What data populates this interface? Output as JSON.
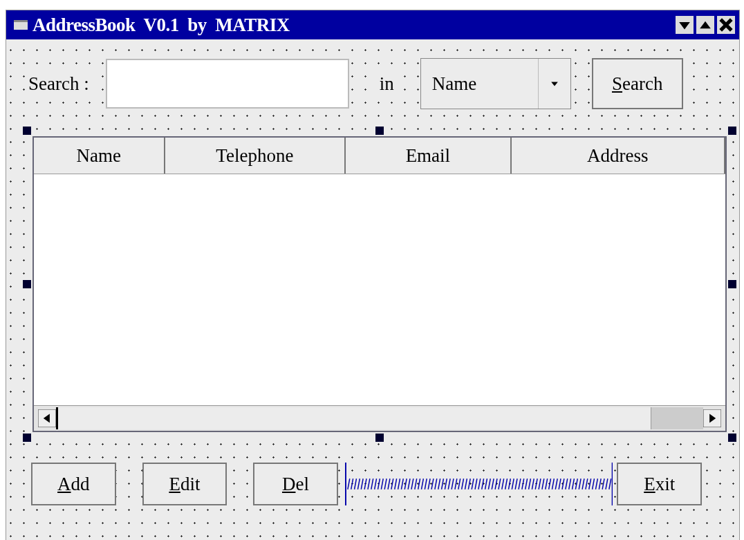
{
  "window": {
    "title": "AddressBook  V0.1  by  MATRIX"
  },
  "search": {
    "label": "Search :",
    "in_label": "in",
    "scope": "Name",
    "button": {
      "label": "Search",
      "underline_first": true
    }
  },
  "table": {
    "columns": [
      "Name",
      "Telephone",
      "Email",
      "Address"
    ],
    "selected": true
  },
  "buttons": [
    {
      "label": "Add",
      "underline_first": true
    },
    {
      "label": "Edit",
      "underline_first": true
    },
    {
      "label": "Del",
      "underline_first": true
    },
    {
      "kind": "spacer"
    },
    {
      "label": "Exit",
      "underline_first": true
    }
  ]
}
